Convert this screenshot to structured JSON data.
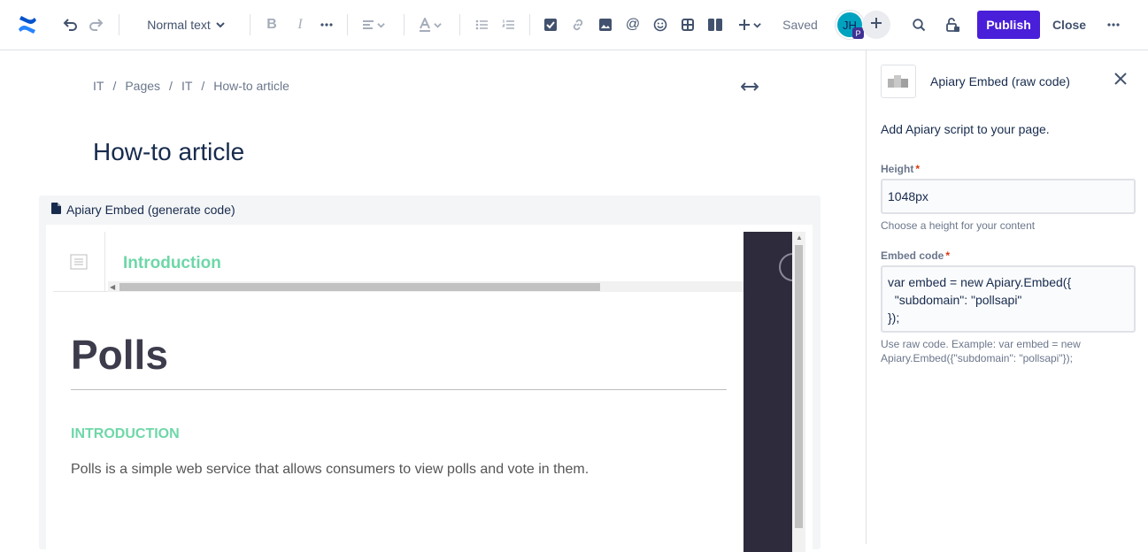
{
  "toolbar": {
    "text_style": "Normal text",
    "saved": "Saved",
    "avatar_initials": "JH",
    "avatar_badge": "P",
    "publish_label": "Publish",
    "close_label": "Close",
    "icons": [
      "confluence-logo-icon",
      "undo-icon",
      "redo-icon",
      "chevron-down-icon",
      "bold-icon",
      "italic-icon",
      "more-formatting-icon",
      "align-icon",
      "text-color-icon",
      "bullet-list-icon",
      "numbered-list-icon",
      "task-icon",
      "link-icon",
      "image-icon",
      "mention-icon",
      "emoji-icon",
      "table-icon",
      "layouts-icon",
      "insert-icon",
      "search-icon",
      "restrictions-icon",
      "more-icon"
    ],
    "accent_color": "#4a1fd9"
  },
  "breadcrumb": [
    "IT",
    "Pages",
    "IT",
    "How-to article"
  ],
  "page": {
    "title": "How-to article"
  },
  "macro": {
    "header_label": "Apiary Embed (generate code)",
    "embed": {
      "nav_title": "Introduction",
      "heading": "Polls",
      "section": "INTRODUCTION",
      "paragraph": "Polls is a simple web service that allows consumers to view polls and vote in them."
    }
  },
  "panel": {
    "title": "Apiary Embed (raw code)",
    "description": "Add Apiary script to your page.",
    "height_label": "Height",
    "height_value": "1048px",
    "height_help": "Choose a height for your content",
    "code_label": "Embed code",
    "code_value": "var embed = new Apiary.Embed({\n  \"subdomain\": \"pollsapi\"\n});",
    "code_help": "Use raw code. Example: var embed = new Apiary.Embed({\"subdomain\": \"pollsapi\"});",
    "required_mark": "*"
  }
}
